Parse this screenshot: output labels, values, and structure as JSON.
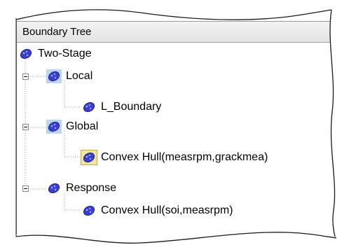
{
  "panel": {
    "title": "Boundary Tree"
  },
  "tree": {
    "nodes": [
      {
        "label": "Two-Stage",
        "expanded": true,
        "level": 0
      },
      {
        "label": "Local",
        "expanded": true,
        "level": 1
      },
      {
        "label": "L_Boundary",
        "level": 2
      },
      {
        "label": "Global",
        "expanded": true,
        "level": 1
      },
      {
        "label": "Convex Hull(measrpm,grackmea)",
        "level": 2,
        "selected": true
      },
      {
        "label": "Response",
        "expanded": true,
        "level": 1
      },
      {
        "label": "Convex Hull(soi,measrpm)",
        "level": 2
      }
    ]
  },
  "colors": {
    "icon_fill": "#3a3fd0",
    "icon_spots": "#9fa6ff",
    "selection": "#f3e6a0",
    "highlight": "#b9d6f2"
  },
  "icons": {
    "node": "boundary-blob-icon",
    "expander": "collapse-minus-icon"
  }
}
